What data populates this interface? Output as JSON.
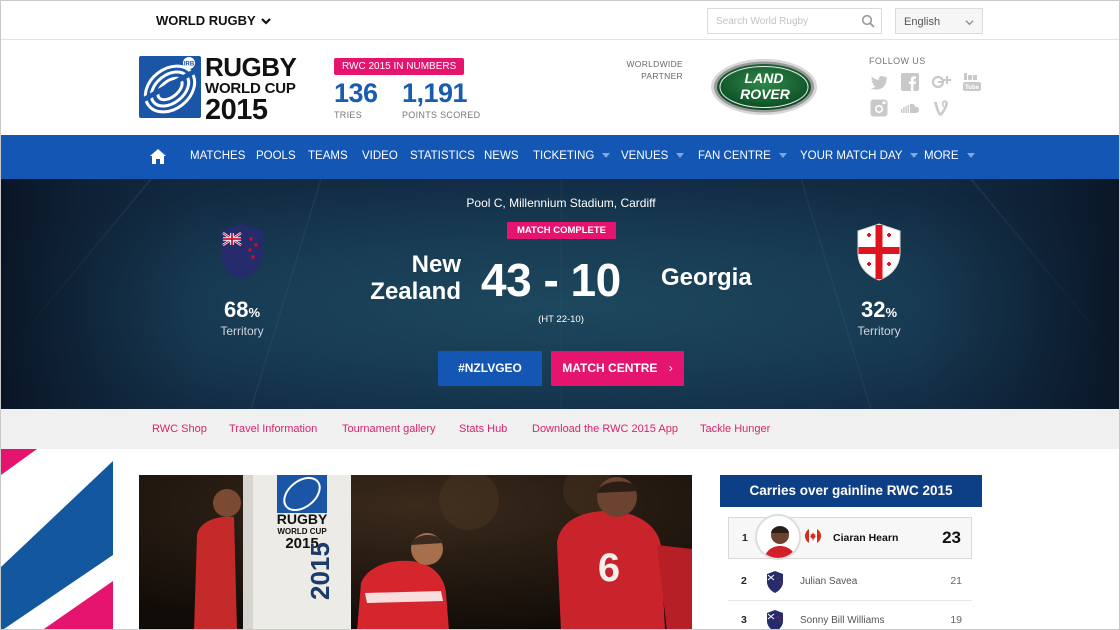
{
  "topbar": {
    "brand_menu": "WORLD RUGBY",
    "search_placeholder": "Search World Rugby",
    "language": "English"
  },
  "header": {
    "logo": {
      "badge": "IRB",
      "line1": "RUGBY",
      "line2": "WORLD CUP",
      "line3": "2015"
    },
    "numbers_badge": "RWC 2015 IN NUMBERS",
    "stats": [
      {
        "value": "136",
        "label": "TRIES"
      },
      {
        "value": "1,191",
        "label": "POINTS SCORED"
      }
    ],
    "partner_line1": "WORLDWIDE",
    "partner_line2": "PARTNER",
    "partner_logo": {
      "line1": "LAND",
      "line2": "ROVER"
    },
    "follow_label": "FOLLOW US"
  },
  "nav": {
    "items": [
      "MATCHES",
      "POOLS",
      "TEAMS",
      "VIDEO",
      "STATISTICS",
      "NEWS",
      "TICKETING",
      "VENUES",
      "FAN CENTRE",
      "YOUR MATCH DAY",
      "MORE"
    ]
  },
  "match": {
    "venue": "Pool C, Millennium Stadium, Cardiff",
    "status": "MATCH COMPLETE",
    "home": {
      "line1": "New",
      "line2": "Zealand",
      "territory": "68",
      "pct_sign": "%",
      "territory_label": "Territory"
    },
    "away": {
      "name": "Georgia",
      "territory": "32",
      "pct_sign": "%",
      "territory_label": "Territory"
    },
    "score": "43 - 10",
    "halftime": "(HT 22-10)",
    "hashtag_button": "#NZLVGEO",
    "match_centre_button": "MATCH CENTRE",
    "colors": {
      "pink": "#e5156f",
      "blue": "#1356b4"
    }
  },
  "subnav": {
    "links": [
      "RWC Shop",
      "Travel Information",
      "Tournament gallery",
      "Stats Hub",
      "Download the RWC 2015 App",
      "Tackle Hunger"
    ]
  },
  "photo": {
    "logo_line1": "RUGBY",
    "logo_line2": "WORLD CUP",
    "logo_line3": "2015",
    "post_text": "2015",
    "jersey_number": "6"
  },
  "leaderboard": {
    "title": "Carries over gainline RWC 2015",
    "rows": [
      {
        "rank": "1",
        "name": "Ciaran Hearn",
        "value": "23"
      },
      {
        "rank": "2",
        "name": "Julian Savea",
        "value": "21"
      },
      {
        "rank": "3",
        "name": "Sonny Bill Williams",
        "value": "19"
      }
    ]
  }
}
